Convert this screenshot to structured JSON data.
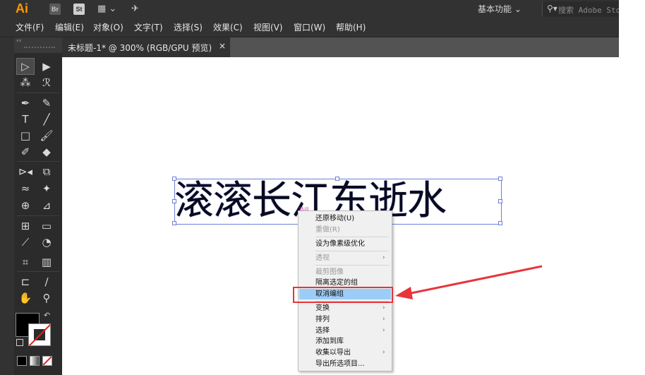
{
  "app": {
    "logo": "Ai",
    "br_label": "Br",
    "st_label": "St"
  },
  "topbar": {
    "workspace": "基本功能",
    "search_placeholder": "搜索 Adobe Stock"
  },
  "menubar": [
    "文件(F)",
    "编辑(E)",
    "对象(O)",
    "文字(T)",
    "选择(S)",
    "效果(C)",
    "视图(V)",
    "窗口(W)",
    "帮助(H)"
  ],
  "tab": {
    "title": "未标题-1* @ 300% (RGB/GPU 预览)",
    "close": "×"
  },
  "canvas": {
    "text": "滚滚长江东逝水",
    "anchor_label": "路径"
  },
  "context_menu": {
    "items": [
      {
        "label": "还原移动(U)",
        "disabled": false,
        "submenu": false
      },
      {
        "label": "重做(R)",
        "disabled": true,
        "submenu": false
      },
      {
        "label": "设为像素级优化",
        "disabled": false,
        "submenu": false
      },
      {
        "label": "透视",
        "disabled": true,
        "submenu": true
      },
      {
        "label": "裁剪图像",
        "disabled": true,
        "submenu": false
      },
      {
        "label": "隔离选定的组",
        "disabled": false,
        "submenu": false
      },
      {
        "label": "取消编组",
        "disabled": false,
        "submenu": false,
        "highlighted": true
      },
      {
        "label": "变换",
        "disabled": false,
        "submenu": true
      },
      {
        "label": "排列",
        "disabled": false,
        "submenu": true
      },
      {
        "label": "选择",
        "disabled": false,
        "submenu": true
      },
      {
        "label": "添加到库",
        "disabled": false,
        "submenu": false
      },
      {
        "label": "收集以导出",
        "disabled": false,
        "submenu": true
      },
      {
        "label": "导出所选项目...",
        "disabled": false,
        "submenu": false
      }
    ]
  },
  "colors": {
    "ui_dark": "#323232",
    "toolbar": "#2b2b2b",
    "selection_blue": "#6f7fd6",
    "menu_highlight": "#9bcdf7",
    "annotation_red": "#e8343a",
    "ai_orange": "#ff9a00"
  },
  "icons": {
    "submenu": "›",
    "swap": "↶",
    "search": "⚲"
  }
}
